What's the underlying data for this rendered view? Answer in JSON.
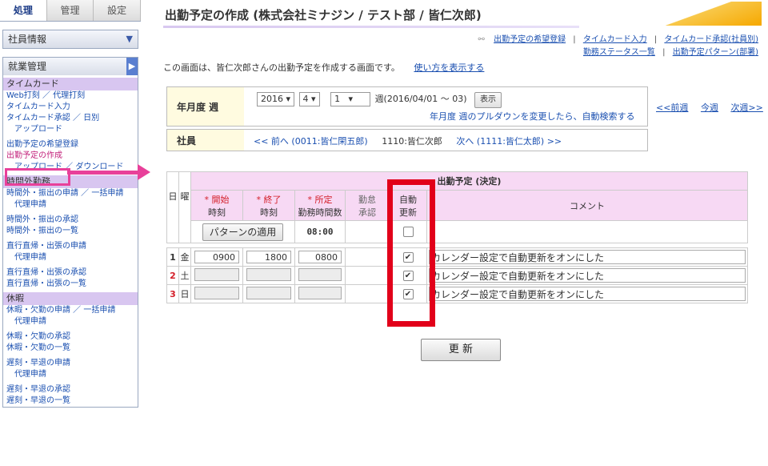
{
  "sidebar": {
    "tabs": [
      "処理",
      "管理",
      "設定"
    ],
    "employee_info": "社員情報",
    "work_mgmt": "就業管理",
    "sections": [
      {
        "title": "タイムカード",
        "items": [
          {
            "label": "Web打刻 ／ 代理打刻",
            "indent": false
          },
          {
            "label": "タイムカード入力",
            "indent": false
          },
          {
            "label": "タイムカード承認 ／ 日別",
            "indent": false
          },
          {
            "label": "アップロード",
            "indent": true
          },
          {
            "label": "",
            "indent": false,
            "gap": true
          },
          {
            "label": "出勤予定の希望登録",
            "indent": false
          },
          {
            "label": "出勤予定の作成",
            "indent": false,
            "current": true
          },
          {
            "label": "アップロード ／ ダウンロード",
            "indent": true
          }
        ]
      },
      {
        "title": "時間外勤務",
        "items": [
          {
            "label": "時間外・振出の申請 ／ 一括申請",
            "indent": false
          },
          {
            "label": "代理申請",
            "indent": true
          },
          {
            "label": "",
            "gap": true
          },
          {
            "label": "時間外・振出の承認",
            "indent": false
          },
          {
            "label": "時間外・振出の一覧",
            "indent": false
          },
          {
            "label": "",
            "gap": true
          },
          {
            "label": "直行直帰・出張の申請",
            "indent": false
          },
          {
            "label": "代理申請",
            "indent": true
          },
          {
            "label": "",
            "gap": true
          },
          {
            "label": "直行直帰・出張の承認",
            "indent": false
          },
          {
            "label": "直行直帰・出張の一覧",
            "indent": false
          }
        ]
      },
      {
        "title": "休暇",
        "items": [
          {
            "label": "休暇・欠勤の申請 ／ 一括申請",
            "indent": false
          },
          {
            "label": "代理申請",
            "indent": true
          },
          {
            "label": "",
            "gap": true
          },
          {
            "label": "休暇・欠勤の承認",
            "indent": false
          },
          {
            "label": "休暇・欠勤の一覧",
            "indent": false
          },
          {
            "label": "",
            "gap": true
          },
          {
            "label": "遅刻・早退の申請",
            "indent": false
          },
          {
            "label": "代理申請",
            "indent": true
          },
          {
            "label": "",
            "gap": true
          },
          {
            "label": "遅刻・早退の承認",
            "indent": false
          },
          {
            "label": "遅刻・早退の一覧",
            "indent": false
          }
        ]
      }
    ]
  },
  "main": {
    "title": "出勤予定の作成 (株式会社ミナジン / テスト部 / 皆仁次郎)",
    "links_row1": [
      "出勤予定の希望登録",
      "タイムカード入力",
      "タイムカード承認(社員別)"
    ],
    "links_row2": [
      "勤務ステータス一覧",
      "出勤予定パターン(部署)"
    ],
    "intro_text": "この画面は、皆仁次郎さんの出勤予定を作成する画面です。",
    "intro_link": "使い方を表示する",
    "week_label": "年月度 週",
    "year": "2016",
    "month": "4",
    "week": "1",
    "week_suffix": "週(2016/04/01 ～ 03)",
    "show_button": "表示",
    "note": "年月度 週のプルダウンを変更したら、自動検索する",
    "nav_prev": "<<前週",
    "nav_this": "今週",
    "nav_next": "次週>>",
    "employee_label": "社員",
    "emp_prev": "<< 前へ (0011:皆仁閑五郎)",
    "emp_current": "1110:皆仁次郎",
    "emp_next": "次へ (1111:皆仁太郎) >>"
  },
  "table": {
    "group_header": "出勤予定 (決定)",
    "col_day": "日",
    "col_weekday": "曜",
    "col_start": "* 開始",
    "col_start2": "時刻",
    "col_end": "* 終了",
    "col_end2": "時刻",
    "col_sched": "* 所定",
    "col_sched2": "勤務時間数",
    "col_approve": "勤怠",
    "col_approve2": "承認",
    "col_auto": "自動",
    "col_auto2": "更新",
    "col_comment": "コメント",
    "pattern_button": "パターンの適用",
    "pattern_time": "08:00",
    "rows": [
      {
        "day": "1",
        "weekday": "金",
        "start": "0900",
        "end": "1800",
        "sched": "0800",
        "auto": true,
        "comment": "カレンダー設定で自動更新をオンにした",
        "holiday": false
      },
      {
        "day": "2",
        "weekday": "土",
        "start": "",
        "end": "",
        "sched": "",
        "auto": true,
        "comment": "カレンダー設定で自動更新をオンにした",
        "holiday": true
      },
      {
        "day": "3",
        "weekday": "日",
        "start": "",
        "end": "",
        "sched": "",
        "auto": true,
        "comment": "カレンダー設定で自動更新をオンにした",
        "holiday": true
      }
    ]
  },
  "update_button": "更 新",
  "colors": {
    "accent": "#e2001a",
    "pink": "#e8409a",
    "header": "#f7d9f4",
    "section": "#d8c6f0"
  }
}
